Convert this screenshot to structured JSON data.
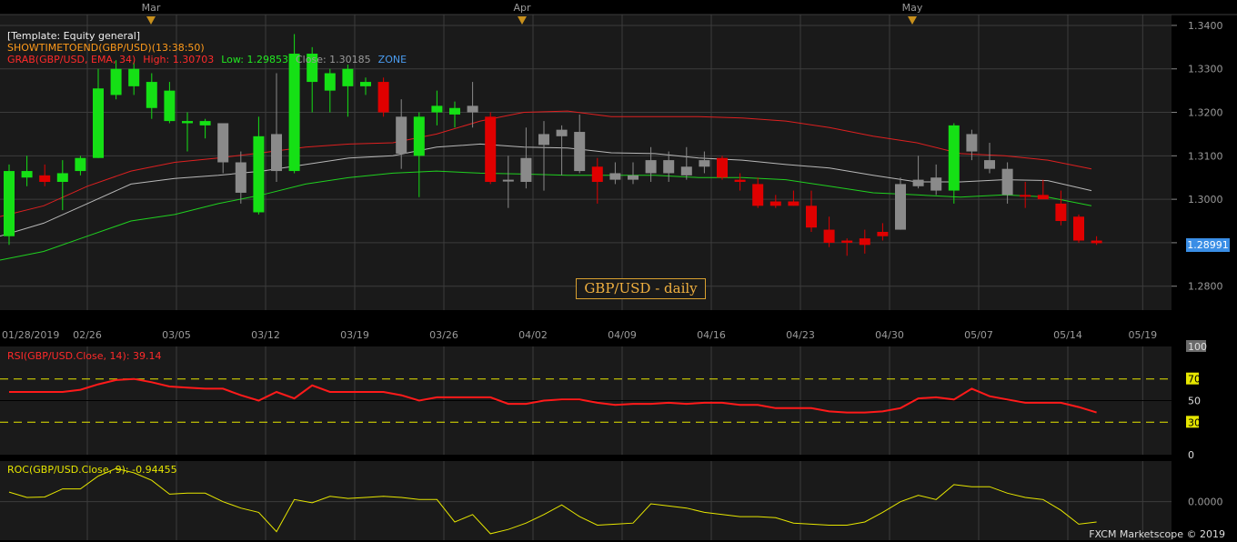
{
  "colors": {
    "background": "#000000",
    "panel": "#1a1a1a",
    "grid": "#3c3c3c",
    "bull": "#15e015",
    "bear": "#e00000",
    "neutral": "#8a8a8a",
    "ema_high": "#dd2020",
    "ema_close": "#b8b8b8",
    "ema_low": "#20d020",
    "rsi": "#ff1a1a",
    "rsi_band": "#e6e600",
    "roc": "#e6e600",
    "month_marker": "#c8901c",
    "last_price_bg": "#3a8ee6"
  },
  "price_panel": {
    "template_label": "[Template: Equity general]",
    "show_time_label": "SHOWTIMETOEND(GBP/USD)(13:38:50)",
    "ema_label": "GRAB(GBP/USD, EMA, 34)",
    "high_label": "High: 1.30703",
    "low_label": "Low: 1.29853",
    "close_label": "Close: 1.30185",
    "zone_label": "ZONE",
    "caption": "GBP/USD - daily",
    "last_price": "1.28991"
  },
  "rsi_panel": {
    "label": "RSI(GBP/USD.Close, 14): 39.14"
  },
  "roc_panel": {
    "label": "ROC(GBP/USD.Close, 9): -0.94455"
  },
  "footer": {
    "copyright": "FXCM Marketscope © 2019"
  },
  "chart_data": [
    {
      "type": "candlestick",
      "symbol": "GBP/USD",
      "month_labels": [
        "Mar",
        "Apr",
        "May"
      ],
      "x_ticks": [
        "01/28/2019",
        "02/26",
        "03/05",
        "03/12",
        "03/19",
        "03/26",
        "04/02",
        "04/09",
        "04/16",
        "04/23",
        "04/30",
        "05/07",
        "05/14",
        "05/19"
      ],
      "y_ticks": [
        "1.3400",
        "1.3300",
        "1.3200",
        "1.3100",
        "1.3000",
        "1.2900",
        "1.2800"
      ],
      "ylim": [
        1.2745,
        1.3425
      ],
      "candles": [
        {
          "o": 1.2915,
          "h": 1.308,
          "l": 1.2895,
          "c": 1.3065,
          "k": "bull"
        },
        {
          "o": 1.305,
          "h": 1.31,
          "l": 1.303,
          "c": 1.3065,
          "k": "bull"
        },
        {
          "o": 1.3055,
          "h": 1.308,
          "l": 1.303,
          "c": 1.304,
          "k": "bear"
        },
        {
          "o": 1.304,
          "h": 1.309,
          "l": 1.2975,
          "c": 1.306,
          "k": "bull"
        },
        {
          "o": 1.3065,
          "h": 1.31,
          "l": 1.3055,
          "c": 1.3095,
          "k": "bull"
        },
        {
          "o": 1.3095,
          "h": 1.33,
          "l": 1.3095,
          "c": 1.3255,
          "k": "bull"
        },
        {
          "o": 1.324,
          "h": 1.332,
          "l": 1.323,
          "c": 1.33,
          "k": "bull"
        },
        {
          "o": 1.33,
          "h": 1.3315,
          "l": 1.324,
          "c": 1.326,
          "k": "bull"
        },
        {
          "o": 1.327,
          "h": 1.329,
          "l": 1.3185,
          "c": 1.321,
          "k": "bull"
        },
        {
          "o": 1.325,
          "h": 1.327,
          "l": 1.3175,
          "c": 1.318,
          "k": "bull"
        },
        {
          "o": 1.318,
          "h": 1.32,
          "l": 1.311,
          "c": 1.3175,
          "k": "bull"
        },
        {
          "o": 1.318,
          "h": 1.3185,
          "l": 1.314,
          "c": 1.317,
          "k": "bull"
        },
        {
          "o": 1.3175,
          "h": 1.3175,
          "l": 1.306,
          "c": 1.3085,
          "k": "neutral"
        },
        {
          "o": 1.3085,
          "h": 1.311,
          "l": 1.299,
          "c": 1.3015,
          "k": "neutral"
        },
        {
          "o": 1.297,
          "h": 1.319,
          "l": 1.2965,
          "c": 1.3145,
          "k": "bull"
        },
        {
          "o": 1.315,
          "h": 1.329,
          "l": 1.304,
          "c": 1.3065,
          "k": "neutral"
        },
        {
          "o": 1.3065,
          "h": 1.338,
          "l": 1.306,
          "c": 1.3335,
          "k": "bull"
        },
        {
          "o": 1.327,
          "h": 1.335,
          "l": 1.32,
          "c": 1.3335,
          "k": "bull"
        },
        {
          "o": 1.325,
          "h": 1.33,
          "l": 1.32,
          "c": 1.329,
          "k": "bull"
        },
        {
          "o": 1.326,
          "h": 1.331,
          "l": 1.319,
          "c": 1.33,
          "k": "bull"
        },
        {
          "o": 1.326,
          "h": 1.328,
          "l": 1.324,
          "c": 1.327,
          "k": "bull"
        },
        {
          "o": 1.327,
          "h": 1.328,
          "l": 1.319,
          "c": 1.32,
          "k": "bear"
        },
        {
          "o": 1.319,
          "h": 1.323,
          "l": 1.307,
          "c": 1.3105,
          "k": "neutral"
        },
        {
          "o": 1.31,
          "h": 1.32,
          "l": 1.3005,
          "c": 1.319,
          "k": "bull"
        },
        {
          "o": 1.32,
          "h": 1.325,
          "l": 1.317,
          "c": 1.3215,
          "k": "bull"
        },
        {
          "o": 1.3195,
          "h": 1.3225,
          "l": 1.3165,
          "c": 1.321,
          "k": "bull"
        },
        {
          "o": 1.32,
          "h": 1.327,
          "l": 1.3165,
          "c": 1.3215,
          "k": "neutral"
        },
        {
          "o": 1.319,
          "h": 1.32,
          "l": 1.3035,
          "c": 1.304,
          "k": "bear"
        },
        {
          "o": 1.3045,
          "h": 1.31,
          "l": 1.298,
          "c": 1.3045,
          "k": "neutral"
        },
        {
          "o": 1.304,
          "h": 1.3165,
          "l": 1.3025,
          "c": 1.3095,
          "k": "neutral"
        },
        {
          "o": 1.3125,
          "h": 1.318,
          "l": 1.302,
          "c": 1.315,
          "k": "neutral"
        },
        {
          "o": 1.3145,
          "h": 1.317,
          "l": 1.3055,
          "c": 1.316,
          "k": "neutral"
        },
        {
          "o": 1.3065,
          "h": 1.3195,
          "l": 1.306,
          "c": 1.3155,
          "k": "neutral"
        },
        {
          "o": 1.3075,
          "h": 1.3095,
          "l": 1.299,
          "c": 1.304,
          "k": "bear"
        },
        {
          "o": 1.3045,
          "h": 1.3085,
          "l": 1.3035,
          "c": 1.306,
          "k": "neutral"
        },
        {
          "o": 1.3045,
          "h": 1.3085,
          "l": 1.3035,
          "c": 1.3055,
          "k": "neutral"
        },
        {
          "o": 1.306,
          "h": 1.312,
          "l": 1.304,
          "c": 1.309,
          "k": "neutral"
        },
        {
          "o": 1.306,
          "h": 1.311,
          "l": 1.304,
          "c": 1.309,
          "k": "neutral"
        },
        {
          "o": 1.3055,
          "h": 1.312,
          "l": 1.3045,
          "c": 1.3075,
          "k": "neutral"
        },
        {
          "o": 1.3075,
          "h": 1.311,
          "l": 1.306,
          "c": 1.309,
          "k": "neutral"
        },
        {
          "o": 1.3095,
          "h": 1.31,
          "l": 1.3045,
          "c": 1.305,
          "k": "bear"
        },
        {
          "o": 1.3045,
          "h": 1.306,
          "l": 1.302,
          "c": 1.304,
          "k": "bear"
        },
        {
          "o": 1.3035,
          "h": 1.305,
          "l": 1.298,
          "c": 1.2985,
          "k": "bear"
        },
        {
          "o": 1.2995,
          "h": 1.301,
          "l": 1.298,
          "c": 1.2985,
          "k": "bear"
        },
        {
          "o": 1.2995,
          "h": 1.302,
          "l": 1.2985,
          "c": 1.2985,
          "k": "bear"
        },
        {
          "o": 1.2985,
          "h": 1.302,
          "l": 1.2925,
          "c": 1.2935,
          "k": "bear"
        },
        {
          "o": 1.293,
          "h": 1.296,
          "l": 1.289,
          "c": 1.29,
          "k": "bear"
        },
        {
          "o": 1.2905,
          "h": 1.291,
          "l": 1.287,
          "c": 1.29,
          "k": "bear"
        },
        {
          "o": 1.291,
          "h": 1.293,
          "l": 1.2875,
          "c": 1.2895,
          "k": "bear"
        },
        {
          "o": 1.2925,
          "h": 1.2945,
          "l": 1.2905,
          "c": 1.2915,
          "k": "bear"
        },
        {
          "o": 1.293,
          "h": 1.305,
          "l": 1.293,
          "c": 1.3035,
          "k": "neutral"
        },
        {
          "o": 1.303,
          "h": 1.31,
          "l": 1.3025,
          "c": 1.3045,
          "k": "neutral"
        },
        {
          "o": 1.302,
          "h": 1.308,
          "l": 1.301,
          "c": 1.305,
          "k": "neutral"
        },
        {
          "o": 1.302,
          "h": 1.3175,
          "l": 1.299,
          "c": 1.317,
          "k": "bull"
        },
        {
          "o": 1.315,
          "h": 1.316,
          "l": 1.309,
          "c": 1.311,
          "k": "neutral"
        },
        {
          "o": 1.309,
          "h": 1.313,
          "l": 1.306,
          "c": 1.307,
          "k": "neutral"
        },
        {
          "o": 1.307,
          "h": 1.3085,
          "l": 1.299,
          "c": 1.301,
          "k": "neutral"
        },
        {
          "o": 1.301,
          "h": 1.304,
          "l": 1.298,
          "c": 1.301,
          "k": "bear"
        },
        {
          "o": 1.3,
          "h": 1.3045,
          "l": 1.3005,
          "c": 1.301,
          "k": "bear"
        },
        {
          "o": 1.299,
          "h": 1.302,
          "l": 1.294,
          "c": 1.295,
          "k": "bear"
        },
        {
          "o": 1.296,
          "h": 1.2965,
          "l": 1.29,
          "c": 1.2905,
          "k": "bear"
        },
        {
          "o": 1.2905,
          "h": 1.2915,
          "l": 1.2895,
          "c": 1.2899,
          "k": "bear"
        }
      ],
      "ema_high": [
        1.296,
        1.2985,
        1.303,
        1.3065,
        1.3085,
        1.3095,
        1.3107,
        1.312,
        1.3127,
        1.313,
        1.315,
        1.318,
        1.32,
        1.3203,
        1.319,
        1.319,
        1.319,
        1.3187,
        1.318,
        1.3165,
        1.3145,
        1.313,
        1.3105,
        1.31,
        1.309,
        1.307
      ],
      "ema_close": [
        1.2915,
        1.2945,
        1.299,
        1.3035,
        1.3048,
        1.3055,
        1.3065,
        1.308,
        1.3095,
        1.31,
        1.312,
        1.3127,
        1.312,
        1.3118,
        1.3107,
        1.3105,
        1.3095,
        1.309,
        1.308,
        1.3072,
        1.3055,
        1.304,
        1.304,
        1.3045,
        1.3043,
        1.302
      ],
      "ema_low": [
        1.286,
        1.288,
        1.2915,
        1.295,
        1.2965,
        1.299,
        1.301,
        1.3035,
        1.305,
        1.306,
        1.3065,
        1.306,
        1.3058,
        1.3055,
        1.3055,
        1.3055,
        1.305,
        1.305,
        1.3045,
        1.303,
        1.3015,
        1.301,
        1.3005,
        1.301,
        1.3005,
        1.2985
      ]
    },
    {
      "type": "line",
      "name": "RSI",
      "y_ticks": [
        "100",
        "70",
        "50",
        "30",
        "0"
      ],
      "ylim": [
        0,
        100
      ],
      "bands": [
        70,
        30
      ],
      "values": [
        58,
        58,
        58,
        58,
        60,
        65,
        69,
        70,
        67,
        63,
        62,
        61,
        61,
        55,
        50,
        58,
        52,
        64,
        58,
        58,
        58,
        58,
        55,
        50,
        53,
        53,
        53,
        53,
        47,
        47,
        50,
        51,
        51,
        48,
        46,
        47,
        47,
        48,
        47,
        48,
        48,
        46,
        46,
        43,
        43,
        43,
        40,
        39,
        39,
        40,
        43,
        52,
        53,
        51,
        61,
        54,
        51,
        48,
        48,
        48,
        44,
        39
      ]
    },
    {
      "type": "line",
      "name": "ROC",
      "y_ticks": [
        "0.0000"
      ],
      "values": [
        0.45,
        0.2,
        0.22,
        0.6,
        0.6,
        1.2,
        1.55,
        1.35,
        1.0,
        0.35,
        0.4,
        0.4,
        0.0,
        -0.3,
        -0.5,
        -1.4,
        0.1,
        -0.05,
        0.25,
        0.15,
        0.2,
        0.25,
        0.2,
        0.1,
        0.1,
        -0.95,
        -0.6,
        -1.5,
        -1.3,
        -1.0,
        -0.6,
        -0.15,
        -0.7,
        -1.1,
        -1.05,
        -1.0,
        -0.1,
        -0.2,
        -0.3,
        -0.5,
        -0.6,
        -0.7,
        -0.7,
        -0.75,
        -1.0,
        -1.05,
        -1.1,
        -1.1,
        -0.95,
        -0.5,
        0.0,
        0.3,
        0.1,
        0.8,
        0.7,
        0.7,
        0.4,
        0.2,
        0.1,
        -0.4,
        -1.05,
        -0.95
      ]
    }
  ]
}
